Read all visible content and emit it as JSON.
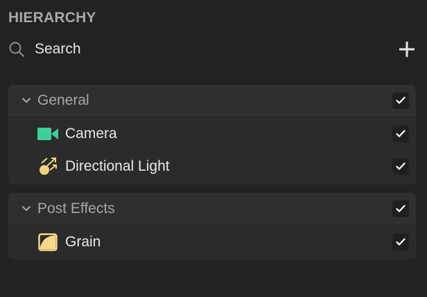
{
  "panel": {
    "title": "HIERARCHY"
  },
  "search": {
    "placeholder": "Search",
    "icon": "search-icon"
  },
  "toolbar": {
    "add_icon": "plus-icon"
  },
  "groups": [
    {
      "label": "General",
      "expanded": true,
      "checked": true,
      "items": [
        {
          "label": "Camera",
          "icon": "camera-icon",
          "icon_color": "#3ecf9a",
          "checked": true
        },
        {
          "label": "Directional Light",
          "icon": "directional-light-icon",
          "icon_color": "#f5d27a",
          "checked": true
        }
      ]
    },
    {
      "label": "Post Effects",
      "expanded": true,
      "checked": true,
      "items": [
        {
          "label": "Grain",
          "icon": "grain-icon",
          "icon_color": "#f7d98a",
          "checked": true
        }
      ]
    }
  ],
  "colors": {
    "background": "#222222",
    "group_background": "#2b2b2b",
    "text": "#e8e8e8",
    "muted_text": "#a6a6a6"
  }
}
